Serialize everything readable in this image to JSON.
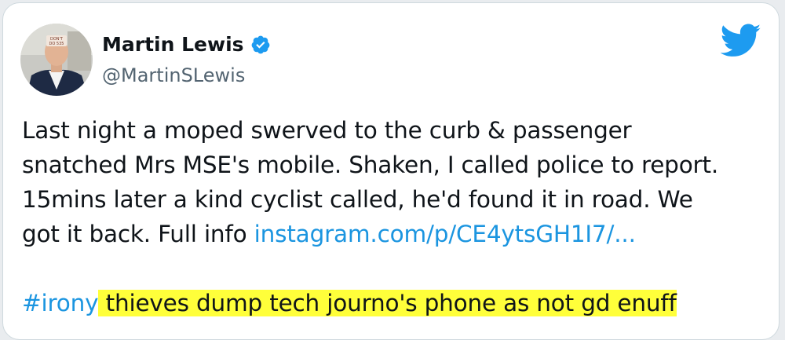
{
  "tweet": {
    "author": {
      "display_name": "Martin Lewis",
      "handle": "@MartinSLewis",
      "verified": true,
      "avatar_badge": "DON'T DO 535"
    },
    "brand_icon": "twitter-bird-icon",
    "lines": [
      "Last night a moped swerved to the curb & passenger",
      "snatched Mrs MSE's mobile. Shaken, I called police to report.",
      "15mins later a kind cyclist called, he'd found it in road. We",
      "got it back. Full info "
    ],
    "link": "instagram.com/p/CE4ytsGH1I7/...",
    "hashtag": "#irony",
    "highlighted_text": "thieves dump tech journo's phone as not gd enuff",
    "colors": {
      "link": "#1b95e0",
      "verified": "#1d9bf0",
      "highlight": "#ffff3a",
      "handle": "#536471"
    }
  }
}
